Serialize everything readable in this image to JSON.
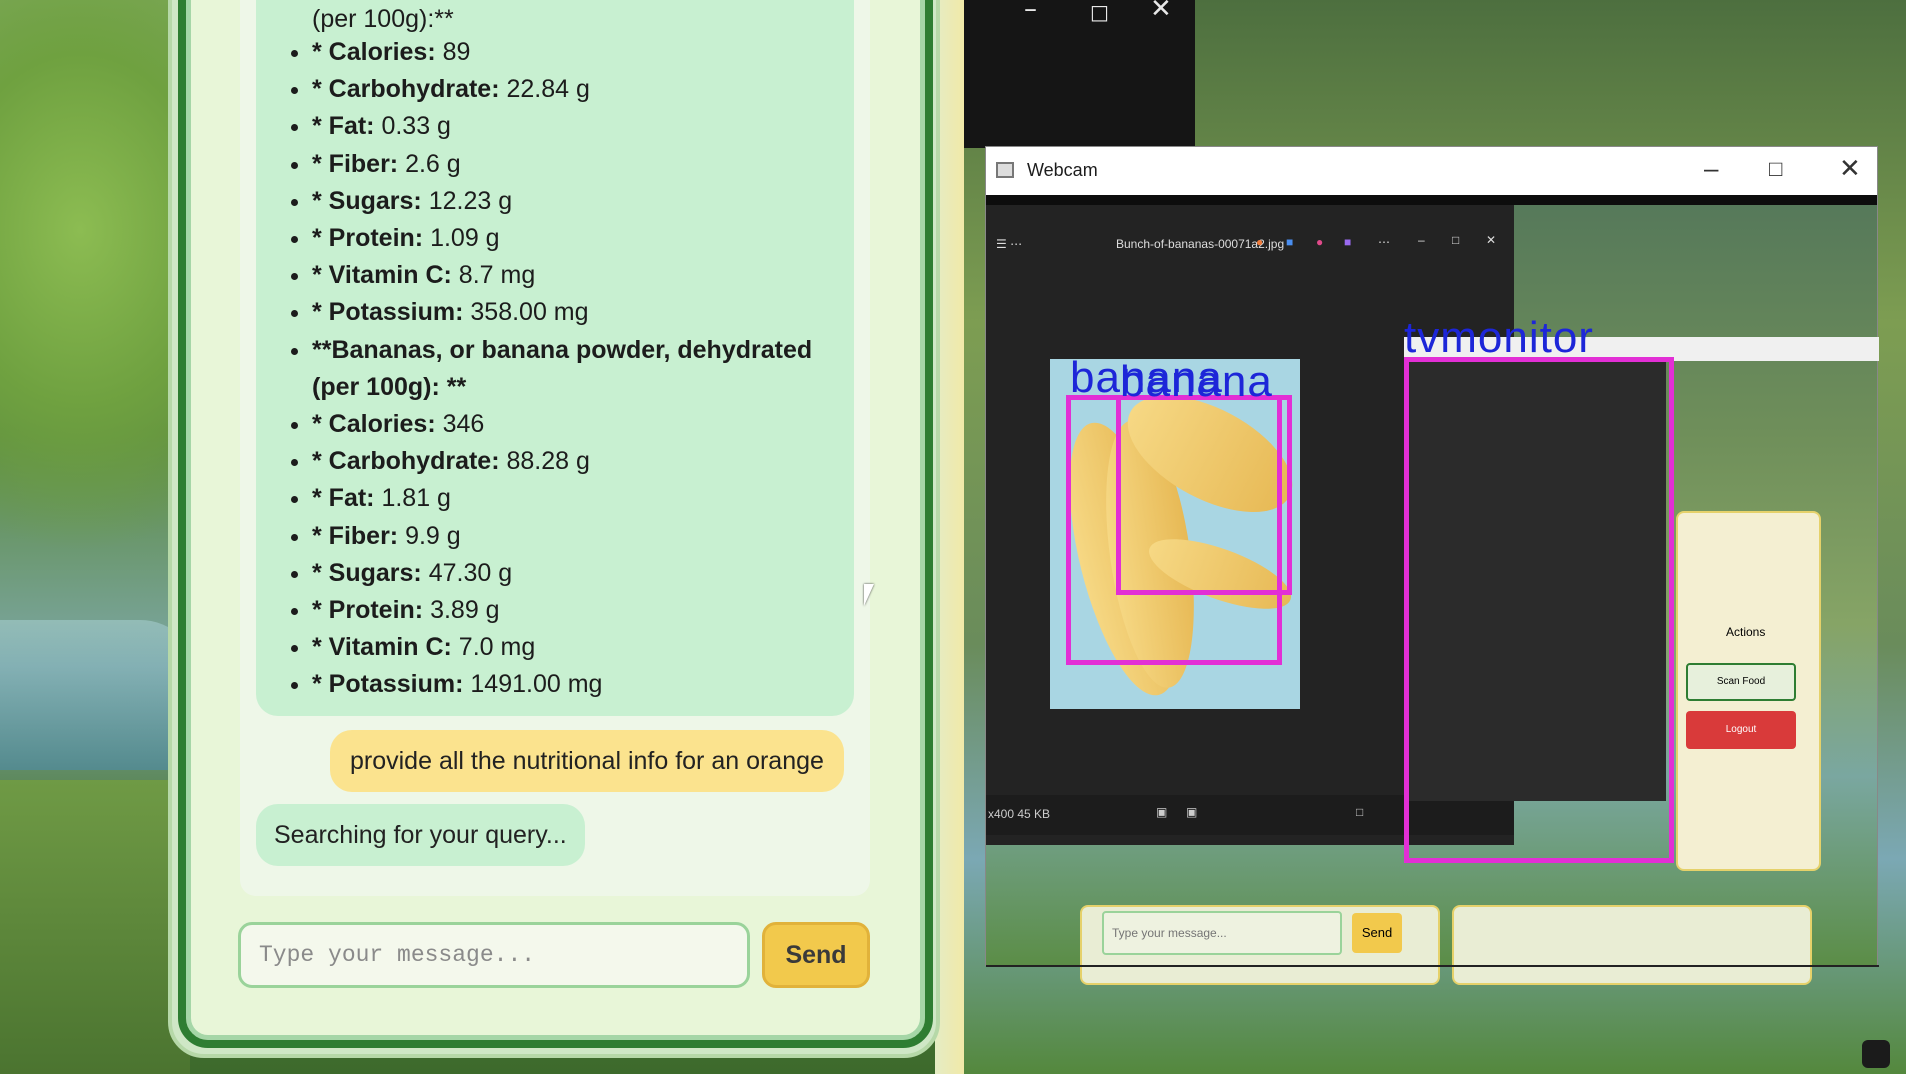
{
  "chat": {
    "first_line": "(per 100g):**",
    "items": [
      {
        "label": "* Calories:",
        "value": " 89"
      },
      {
        "label": "* Carbohydrate:",
        "value": " 22.84 g"
      },
      {
        "label": "* Fat:",
        "value": " 0.33 g"
      },
      {
        "label": "* Fiber:",
        "value": " 2.6 g"
      },
      {
        "label": "* Sugars:",
        "value": " 12.23 g"
      },
      {
        "label": "* Protein:",
        "value": " 1.09 g"
      },
      {
        "label": "* Vitamin C:",
        "value": " 8.7 mg"
      },
      {
        "label": "* Potassium:",
        "value": " 358.00 mg"
      },
      {
        "label": "**Bananas, or banana powder, dehydrated (per 100g): **",
        "value": ""
      },
      {
        "label": "* Calories:",
        "value": " 346"
      },
      {
        "label": "* Carbohydrate:",
        "value": " 88.28 g"
      },
      {
        "label": "* Fat:",
        "value": " 1.81 g"
      },
      {
        "label": "* Fiber:",
        "value": " 9.9 g"
      },
      {
        "label": "* Sugars:",
        "value": " 47.30 g"
      },
      {
        "label": "* Protein:",
        "value": " 3.89 g"
      },
      {
        "label": "* Vitamin C:",
        "value": " 7.0 mg"
      },
      {
        "label": "* Potassium:",
        "value": " 1491.00 mg"
      }
    ],
    "user_message": "provide all the nutritional info for an orange",
    "bot_status": "Searching for your query...",
    "input_placeholder": "Type your message...",
    "send_label": "Send"
  },
  "webcam": {
    "title": "Webcam",
    "viewer_filename": "Bunch-of-bananas-00071a2.jpg",
    "viewer_status": "x400  45 KB",
    "detections": [
      {
        "label": "banana"
      },
      {
        "label": "banana"
      },
      {
        "label": "tvmonitor"
      }
    ],
    "mini_ui": {
      "actions_label": "Actions",
      "scan_food": "Scan Food",
      "logout": "Logout",
      "input_placeholder": "Type your message...",
      "send_label": "Send"
    }
  },
  "colors": {
    "bot_bubble": "#c8f0d1",
    "user_bubble": "#fbe38e",
    "send_button": "#f2c94c",
    "panel_border": "#2e7d32",
    "detection_box": "#e22fd5",
    "detection_label": "#1d26d8"
  }
}
